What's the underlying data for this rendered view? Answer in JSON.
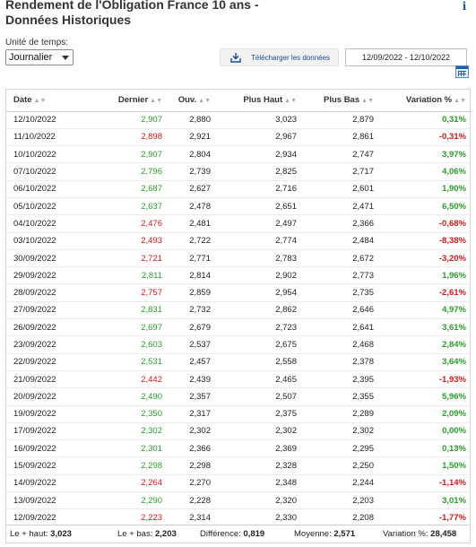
{
  "header": {
    "title_line1": "Rendement de l'Obligation France 10 ans -",
    "title_line2": "Données Historiques"
  },
  "controls": {
    "unit_label": "Unité de temps:",
    "unit_value": "Journalier",
    "download_label": "Télécharger les données",
    "date_range": "12/09/2022 - 12/10/2022"
  },
  "table": {
    "columns": [
      "Date",
      "Dernier",
      "Ouv.",
      "Plus Haut",
      "Plus Bas",
      "Variation %"
    ],
    "rows": [
      {
        "date": "12/10/2022",
        "last": "2,907",
        "open": "2,880",
        "high": "3,023",
        "low": "2,879",
        "chg": "0,31%",
        "dir": "up"
      },
      {
        "date": "11/10/2022",
        "last": "2,898",
        "open": "2,921",
        "high": "2,967",
        "low": "2,861",
        "chg": "-0,31%",
        "dir": "down"
      },
      {
        "date": "10/10/2022",
        "last": "2,907",
        "open": "2,804",
        "high": "2,934",
        "low": "2,747",
        "chg": "3,97%",
        "dir": "up"
      },
      {
        "date": "07/10/2022",
        "last": "2,796",
        "open": "2,739",
        "high": "2,825",
        "low": "2,717",
        "chg": "4,06%",
        "dir": "up"
      },
      {
        "date": "06/10/2022",
        "last": "2,687",
        "open": "2,627",
        "high": "2,716",
        "low": "2,601",
        "chg": "1,90%",
        "dir": "up"
      },
      {
        "date": "05/10/2022",
        "last": "2,637",
        "open": "2,478",
        "high": "2,651",
        "low": "2,471",
        "chg": "6,50%",
        "dir": "up"
      },
      {
        "date": "04/10/2022",
        "last": "2,476",
        "open": "2,481",
        "high": "2,497",
        "low": "2,366",
        "chg": "-0,68%",
        "dir": "down"
      },
      {
        "date": "03/10/2022",
        "last": "2,493",
        "open": "2,722",
        "high": "2,774",
        "low": "2,484",
        "chg": "-8,38%",
        "dir": "down"
      },
      {
        "date": "30/09/2022",
        "last": "2,721",
        "open": "2,771",
        "high": "2,783",
        "low": "2,672",
        "chg": "-3,20%",
        "dir": "down"
      },
      {
        "date": "29/09/2022",
        "last": "2,811",
        "open": "2,814",
        "high": "2,902",
        "low": "2,773",
        "chg": "1,96%",
        "dir": "up"
      },
      {
        "date": "28/09/2022",
        "last": "2,757",
        "open": "2,859",
        "high": "2,954",
        "low": "2,735",
        "chg": "-2,61%",
        "dir": "down"
      },
      {
        "date": "27/09/2022",
        "last": "2,831",
        "open": "2,732",
        "high": "2,862",
        "low": "2,646",
        "chg": "4,97%",
        "dir": "up"
      },
      {
        "date": "26/09/2022",
        "last": "2,697",
        "open": "2,679",
        "high": "2,723",
        "low": "2,641",
        "chg": "3,61%",
        "dir": "up"
      },
      {
        "date": "23/09/2022",
        "last": "2,603",
        "open": "2,537",
        "high": "2,675",
        "low": "2,468",
        "chg": "2,84%",
        "dir": "up"
      },
      {
        "date": "22/09/2022",
        "last": "2,531",
        "open": "2,457",
        "high": "2,558",
        "low": "2,378",
        "chg": "3,64%",
        "dir": "up"
      },
      {
        "date": "21/09/2022",
        "last": "2,442",
        "open": "2,439",
        "high": "2,465",
        "low": "2,395",
        "chg": "-1,93%",
        "dir": "down"
      },
      {
        "date": "20/09/2022",
        "last": "2,490",
        "open": "2,357",
        "high": "2,507",
        "low": "2,355",
        "chg": "5,96%",
        "dir": "up"
      },
      {
        "date": "19/09/2022",
        "last": "2,350",
        "open": "2,317",
        "high": "2,375",
        "low": "2,289",
        "chg": "2,09%",
        "dir": "up"
      },
      {
        "date": "17/09/2022",
        "last": "2,302",
        "open": "2,302",
        "high": "2,302",
        "low": "2,302",
        "chg": "0,00%",
        "dir": "up"
      },
      {
        "date": "16/09/2022",
        "last": "2,301",
        "open": "2,366",
        "high": "2,369",
        "low": "2,295",
        "chg": "0,13%",
        "dir": "up"
      },
      {
        "date": "15/09/2022",
        "last": "2,298",
        "open": "2,298",
        "high": "2,328",
        "low": "2,250",
        "chg": "1,50%",
        "dir": "up"
      },
      {
        "date": "14/09/2022",
        "last": "2,264",
        "open": "2,270",
        "high": "2,348",
        "low": "2,244",
        "chg": "-1,14%",
        "dir": "down"
      },
      {
        "date": "13/09/2022",
        "last": "2,290",
        "open": "2,228",
        "high": "2,320",
        "low": "2,203",
        "chg": "3,01%",
        "dir": "up"
      },
      {
        "date": "12/09/2022",
        "last": "2,223",
        "open": "2,314",
        "high": "2,330",
        "low": "2,208",
        "chg": "-1,77%",
        "dir": "down"
      }
    ]
  },
  "summary": {
    "high_label": "Le + haut:",
    "high_value": "3,023",
    "low_label": "Le + bas:",
    "low_value": "2,203",
    "diff_label": "Différence:",
    "diff_value": "0,819",
    "avg_label": "Moyenne:",
    "avg_value": "2,571",
    "var_label": "Variation %:",
    "var_value": "28,458"
  },
  "colors": {
    "up": "#2a9d2a",
    "down": "#d01a1a",
    "link": "#1a4d8f"
  },
  "icons": [
    "info-icon",
    "download-icon",
    "calendar-icon",
    "sort-icon",
    "chevron-down-icon"
  ]
}
